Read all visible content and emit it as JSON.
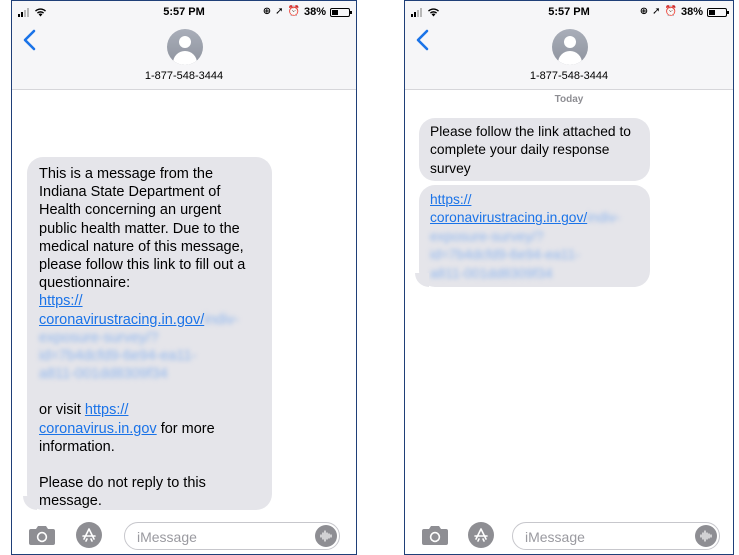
{
  "status_bar": {
    "time": "5:57 PM",
    "battery": "38%",
    "battery_level": 0.38,
    "icons": [
      "signal-icon",
      "wifi-icon",
      "location-lock-icon",
      "location-arrow-icon",
      "alarm-icon",
      "battery-icon"
    ]
  },
  "conversation": {
    "contact": "1-877-548-3444"
  },
  "left_message": {
    "p1": "This is a message from the Indiana State Department of Health concerning an urgent public health matter.  Due to the medical nature of this message, please follow this link to fill out a questionnaire:",
    "link_visible_1": "https://",
    "link_visible_2": "coronavirustracing.in.gov/",
    "link_blurred": "indiv-exposure-survey/?id=7b4dcfd9-6e94-ea11-a811-001dd8309f34",
    "p2_pre": "or visit ",
    "link2_a": "https://",
    "link2_b": "coronavirus.in.gov",
    "p2_post": " for more information.",
    "p3": "Please do not reply to this message."
  },
  "right_messages": {
    "date_label": "Today",
    "text": "Please follow the link attached to complete your daily response survey",
    "link_visible_1": "https://",
    "link_visible_2": "coronavirustracing.in.gov/",
    "link_blurred": "indiv-exposure-survey/?id=7b4dcfd9-6e94-ea11-a811-001dd8309f34"
  },
  "input_bar": {
    "placeholder": "iMessage",
    "icons": [
      "camera-icon",
      "app-store-icon",
      "audio-waveform-icon"
    ]
  },
  "colors": {
    "link": "#1a73e8",
    "bubble": "#e5e5ea",
    "chevron": "#1a73e8",
    "frame": "#1f3f78"
  }
}
